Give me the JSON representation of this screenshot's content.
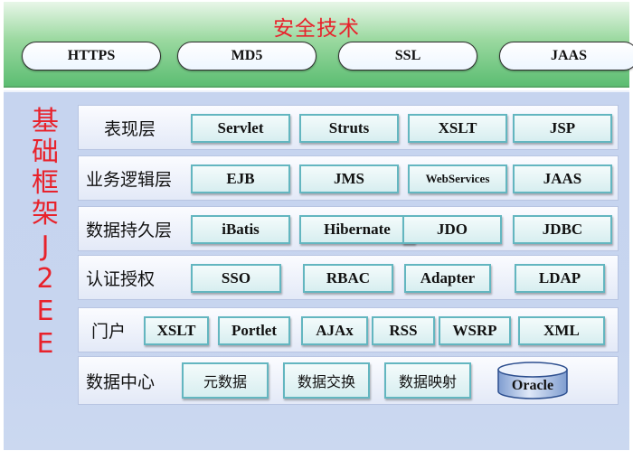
{
  "security": {
    "title": "安全技术",
    "items": [
      "HTTPS",
      "MD5",
      "SSL",
      "JAAS"
    ]
  },
  "framework": {
    "vertical_label": [
      "基",
      "础",
      "框",
      "架",
      "J",
      "2",
      "E",
      "E"
    ],
    "rows": [
      {
        "label": "表现层",
        "items": [
          "Servlet",
          "Struts",
          "XSLT",
          "JSP"
        ]
      },
      {
        "label": "业务逻辑层",
        "items": [
          "EJB",
          "JMS",
          "WebServices",
          "JAAS"
        ]
      },
      {
        "label": "数据持久层",
        "items": [
          "iBatis",
          "Hibernate",
          "JDO",
          "JDBC"
        ]
      },
      {
        "label": "认证授权",
        "items": [
          "SSO",
          "RBAC",
          "Adapter",
          "LDAP"
        ]
      },
      {
        "label": "门户",
        "items": [
          "XSLT",
          "Portlet",
          "AJAx",
          "RSS",
          "WSRP",
          "XML"
        ]
      },
      {
        "label": "数据中心",
        "items": [
          "元数据",
          "数据交换",
          "数据映射",
          "Oracle"
        ]
      }
    ]
  },
  "colors": {
    "title_red": "#e8222b",
    "security_green": "#5cbd72",
    "panel_blue": "#c7d5ef",
    "box_border": "#63b6c0"
  }
}
